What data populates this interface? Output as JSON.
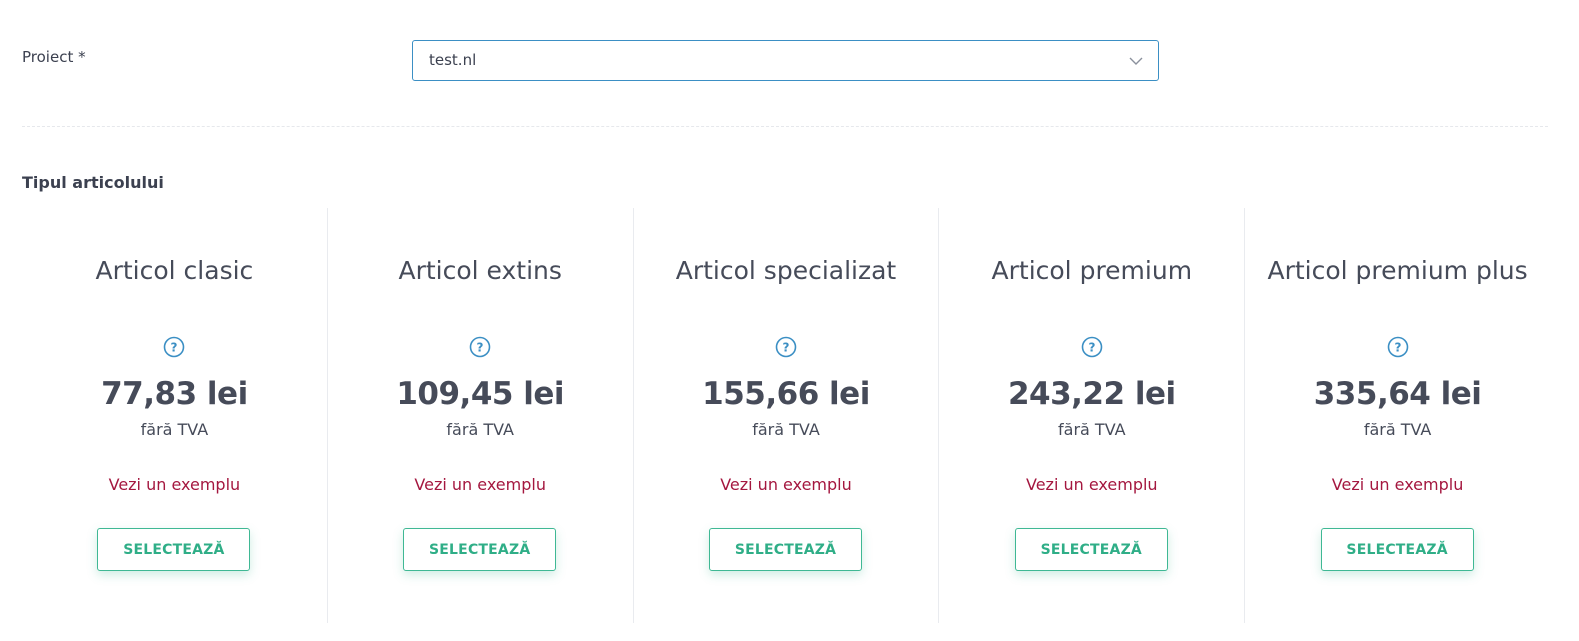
{
  "form": {
    "project_label": "Proiect *",
    "project_value": "test.nl",
    "section_title": "Tipul articolului"
  },
  "icons": {
    "dropdown": "chevron-down-icon",
    "help": "question-circle-icon"
  },
  "colors": {
    "select_border": "#3b8fc4",
    "help_icon": "#3b8fc4",
    "link": "#a4173f",
    "button": "#2fae87"
  },
  "cards": [
    {
      "title": "Articol clasic",
      "price": "77,83 lei",
      "vat": "fără TVA",
      "example": "Vezi un exemplu",
      "button": "SELECTEAZĂ"
    },
    {
      "title": "Articol extins",
      "price": "109,45 lei",
      "vat": "fără TVA",
      "example": "Vezi un exemplu",
      "button": "SELECTEAZĂ"
    },
    {
      "title": "Articol specializat",
      "price": "155,66 lei",
      "vat": "fără TVA",
      "example": "Vezi un exemplu",
      "button": "SELECTEAZĂ"
    },
    {
      "title": "Articol premium",
      "price": "243,22 lei",
      "vat": "fără TVA",
      "example": "Vezi un exemplu",
      "button": "SELECTEAZĂ"
    },
    {
      "title": "Articol premium plus",
      "price": "335,64 lei",
      "vat": "fără TVA",
      "example": "Vezi un exemplu",
      "button": "SELECTEAZĂ"
    }
  ]
}
